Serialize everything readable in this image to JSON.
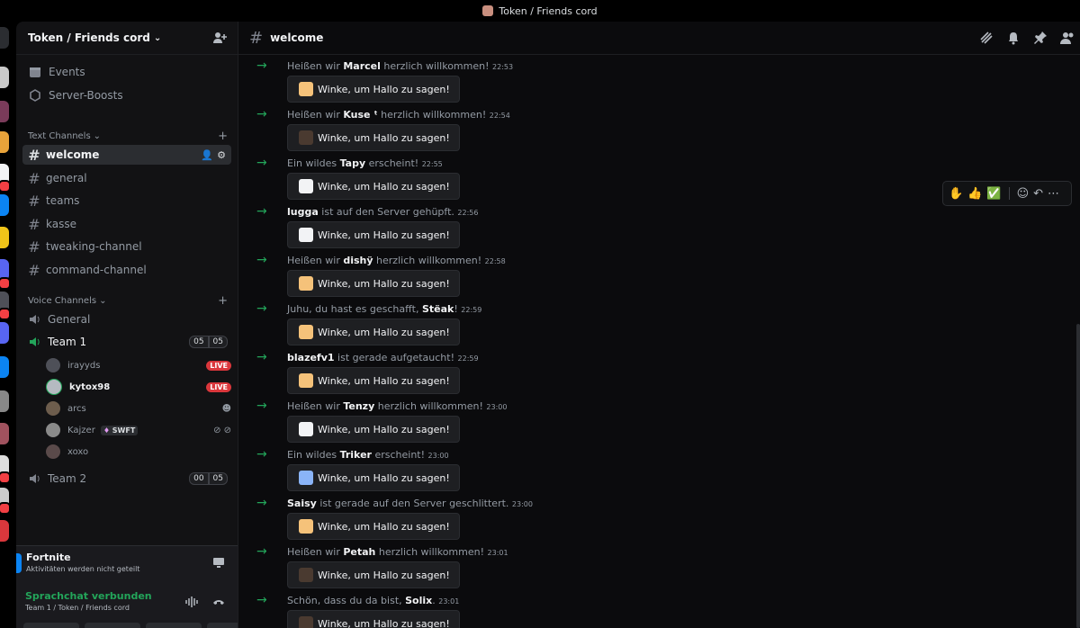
{
  "window_title": "Token / Friends cord",
  "server": {
    "name": "Token / Friends cord"
  },
  "nav": {
    "events": "Events",
    "boosts": "Server-Boosts"
  },
  "text_category": "Text Channels",
  "voice_category": "Voice Channels",
  "text_channels": [
    "welcome",
    "general",
    "teams",
    "kasse",
    "tweaking-channel",
    "command-channel"
  ],
  "voice": {
    "general": "General",
    "team1": {
      "name": "Team 1",
      "count_a": "05",
      "count_b": "05"
    },
    "team2": {
      "name": "Team 2",
      "count_a": "00",
      "count_b": "05"
    },
    "users": [
      {
        "name": "irayyds",
        "live": "LIVE"
      },
      {
        "name": "kytox98",
        "live": "LIVE"
      },
      {
        "name": "arcs"
      },
      {
        "name": "Kajzer",
        "tag": "SWFT"
      },
      {
        "name": "xoxo"
      }
    ]
  },
  "activity": {
    "game": "Fortnite",
    "sub": "Aktivitäten werden nicht geteilt",
    "voice_status": "Sprachchat verbunden",
    "voice_sub": "Team 1 / Token / Friends cord"
  },
  "channel": {
    "name": "welcome"
  },
  "wave_label": "Winke, um Hallo zu sagen!",
  "messages": [
    {
      "pre": "Heißen wir ",
      "name": "Marcel",
      "post": " herzlich willkommen!",
      "time": "22:53"
    },
    {
      "pre": "Heißen wir ",
      "name": "Kuse ᵗ",
      "post": " herzlich willkommen!",
      "time": "22:54"
    },
    {
      "pre": "Ein wildes ",
      "name": "Tapy",
      "post": " erscheint!",
      "time": "22:55"
    },
    {
      "pre": "",
      "name": "lugga",
      "post": " ist auf den Server gehüpft.",
      "time": "22:56"
    },
    {
      "pre": "Heißen wir ",
      "name": "dishÿ",
      "post": " herzlich willkommen!",
      "time": "22:58"
    },
    {
      "pre": "Juhu, du hast es geschafft, ",
      "name": "Stëak",
      "post": "!",
      "time": "22:59"
    },
    {
      "pre": "",
      "name": "blazefv1",
      "post": " ist gerade aufgetaucht!",
      "time": "22:59"
    },
    {
      "pre": "Heißen wir ",
      "name": "Tenzy",
      "post": " herzlich willkommen!",
      "time": "23:00"
    },
    {
      "pre": "Ein wildes ",
      "name": "Triker",
      "post": " erscheint!",
      "time": "23:00"
    },
    {
      "pre": "",
      "name": "Saisy",
      "post": " ist gerade auf den Server geschlittert.",
      "time": "23:00"
    },
    {
      "pre": "Heißen wir ",
      "name": "Petah",
      "post": " herzlich willkommen!",
      "time": "23:01"
    },
    {
      "pre": "Schön, dass du da bist, ",
      "name": "Solix",
      "post": ".",
      "time": "23:01"
    }
  ],
  "reactions": [
    "✋",
    "👍",
    "✅"
  ],
  "colors": {
    "online": "#23a55a",
    "live": "#da373c",
    "background": "#0b0b0d"
  }
}
